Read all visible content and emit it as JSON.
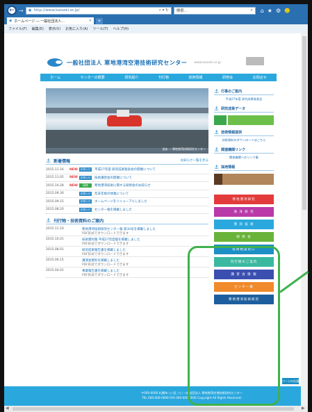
{
  "browser": {
    "address": "http://www.kaiseki.or.jp/",
    "search_label": "検索...",
    "tab_title": "ホームページ ― 一般社団法人...",
    "menu": [
      "ファイル(F)",
      "編集(E)",
      "表示(V)",
      "お気に入り(A)",
      "ツール(T)",
      "ヘルプ(H)"
    ]
  },
  "site": {
    "org_name": "一般社団法人 寒地港湾空港技術研究センター",
    "org_url": "www.kaiseki.or.jp",
    "nav": [
      "ホーム",
      "センターの概要",
      "研究紹介",
      "刊行物",
      "技術情報",
      "研修会",
      "お問合せ"
    ],
    "hero_caption": "流氷 ― 寒地港湾技術研究センター",
    "news_title": "新着情報",
    "news_more": "お知らせ一覧を見る",
    "news": [
      {
        "date": "2015.11.16",
        "new": "NEW",
        "cat": "お知らせ",
        "cat_color": "#2a88c9",
        "title": "平成27年度 研究成果発表会の開催について"
      },
      {
        "date": "2015.11.05",
        "new": "NEW",
        "cat": "お知らせ",
        "cat_color": "#2a88c9",
        "title": "技術講習会の開催について"
      },
      {
        "date": "2015.10.28",
        "new": "NEW",
        "cat": "研修",
        "cat_color": "#3aa84a",
        "title": "寒地港湾技術に関する研修会のお知らせ"
      },
      {
        "date": "2015.09.30",
        "new": "",
        "cat": "お知らせ",
        "cat_color": "#2a88c9",
        "title": "年末年始の休業について"
      },
      {
        "date": "2015.09.15",
        "new": "",
        "cat": "お知らせ",
        "cat_color": "#2a88c9",
        "title": "ホームページをリニューアルしました"
      },
      {
        "date": "2015.08.20",
        "new": "",
        "cat": "お知らせ",
        "cat_color": "#2a88c9",
        "title": "センター報を掲載しました"
      }
    ],
    "pub_title": "刊行物・技術資料のご案内",
    "pubs": [
      {
        "date": "2015.11.10",
        "title": "寒地港湾技術研究センター報 第30号を掲載しました",
        "sub": "PDF形式でダウンロードできます"
      },
      {
        "date": "2015.10.01",
        "title": "技術資料集 平成27年度版を掲載しました",
        "sub": "PDF形式でダウンロードできます"
      },
      {
        "date": "2015.08.01",
        "title": "研究成果報告書を掲載しました",
        "sub": "PDF形式でダウンロードできます"
      },
      {
        "date": "2015.06.15",
        "title": "講演会資料を掲載しました",
        "sub": "PDF形式でダウンロードできます"
      },
      {
        "date": "2015.04.01",
        "title": "事業報告書を掲載しました",
        "sub": "PDF形式でダウンロードできます"
      }
    ],
    "side": {
      "events_title": "行事のご案内",
      "events_text": "平成27年度 研究成果発表会",
      "research_title": "研究成果データ",
      "tech_title": "技術情報提供",
      "tech_text": "技術資料のダウンロードはこちら",
      "link_title": "関連機関リンク",
      "link_text": "関係機関へのリンク集",
      "recruit_title": "採用情報"
    },
    "banners": [
      {
        "label": "寒地港湾研究",
        "color": "#e33b3b"
      },
      {
        "label": "海 洋 研 究",
        "color": "#b93aa8"
      },
      {
        "label": "港 湾 技 術",
        "color": "#2aa8de"
      },
      {
        "label": "研 修 会",
        "color": "#69b33a"
      },
      {
        "label": "技術相談窓口",
        "color": "#1d8fc4"
      },
      {
        "label": "刊行物のご案内",
        "color": "#3ab9a0"
      },
      {
        "label": "講 習 会 情 報",
        "color": "#3a4fb0"
      },
      {
        "label": "センター報",
        "color": "#f08a2a"
      },
      {
        "label": "寒地港湾技術研究",
        "color": "#1d5f9e"
      }
    ],
    "page_top": "ページの先頭へ",
    "footer_line1": "〒000-0000 札幌市 ○○区 ○○ 一般社団法人 寒地港湾空港技術研究センター",
    "footer_line2": "TEL 000-000-0000 FAX 000-000-0000 Copyright All Rights Reserved."
  }
}
